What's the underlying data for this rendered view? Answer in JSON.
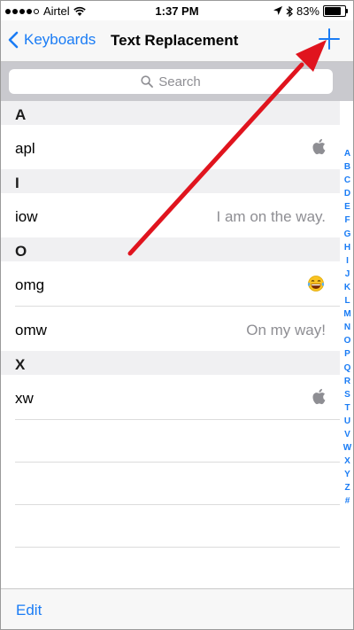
{
  "status_bar": {
    "carrier": "Airtel",
    "time": "1:37 PM",
    "battery": "83%",
    "battery_level": 0.83
  },
  "nav": {
    "back_label": "Keyboards",
    "title": "Text Replacement",
    "add_icon": "plus-icon"
  },
  "search": {
    "placeholder": "Search"
  },
  "sections": [
    {
      "letter": "A",
      "rows": [
        {
          "shortcut": "apl",
          "phrase": "",
          "icon": "apple-logo-icon"
        }
      ]
    },
    {
      "letter": "I",
      "rows": [
        {
          "shortcut": "iow",
          "phrase": "I am on the way."
        }
      ]
    },
    {
      "letter": "O",
      "rows": [
        {
          "shortcut": "omg",
          "phrase": "",
          "icon": "laughing-tears-emoji-icon"
        },
        {
          "shortcut": "omw",
          "phrase": "On my way!"
        }
      ]
    },
    {
      "letter": "X",
      "rows": [
        {
          "shortcut": "xw",
          "phrase": "",
          "icon": "apple-logo-icon"
        }
      ]
    }
  ],
  "index_letters": [
    "A",
    "B",
    "C",
    "D",
    "E",
    "F",
    "G",
    "H",
    "I",
    "J",
    "K",
    "L",
    "M",
    "N",
    "O",
    "P",
    "Q",
    "R",
    "S",
    "T",
    "U",
    "V",
    "W",
    "X",
    "Y",
    "Z",
    "#"
  ],
  "toolbar": {
    "edit_label": "Edit"
  },
  "colors": {
    "accent": "#1a7cf5",
    "annotation_arrow": "#e0141e"
  }
}
